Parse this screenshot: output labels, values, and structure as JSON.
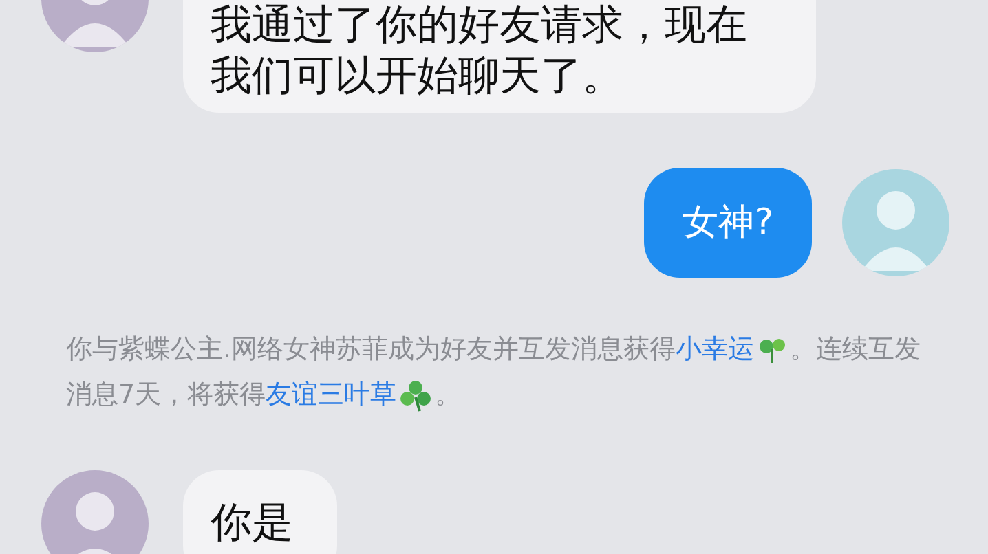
{
  "messages": [
    {
      "kind": "incoming",
      "text": "我通过了你的好友请求，现在我们可以开始聊天了。"
    },
    {
      "kind": "outgoing",
      "text": "女神?"
    }
  ],
  "notice": [
    {
      "kind": "text",
      "text": "你与紫蝶公主.网络女神苏菲成为好友并互发消息获得"
    },
    {
      "kind": "link",
      "text": "小幸运"
    },
    {
      "kind": "sprout"
    },
    {
      "kind": "text",
      "text": "。连续互发消息7天，将获得"
    },
    {
      "kind": "link",
      "text": "友谊三叶草"
    },
    {
      "kind": "clover"
    },
    {
      "kind": "text",
      "text": "。"
    }
  ],
  "last_message": {
    "kind": "incoming",
    "text": "你是"
  }
}
